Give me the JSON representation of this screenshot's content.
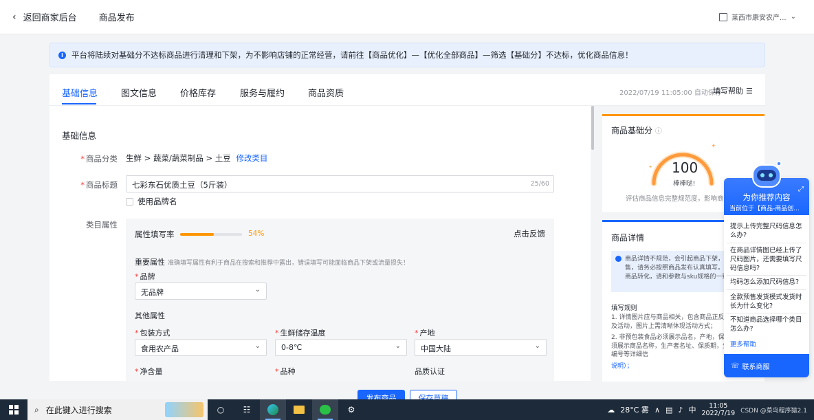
{
  "header": {
    "back_label": "返回商家后台",
    "page_title": "商品发布",
    "shop_name": "莱西市康安农产..."
  },
  "notice": {
    "text": "平台将陆续对基础分不达标商品进行清理和下架，为不影响店铺的正常经营，请前往【商品优化】—【优化全部商品】—筛选【基础分】不达标，优化商品信息！"
  },
  "tabs": {
    "items": [
      "基础信息",
      "图文信息",
      "价格库存",
      "服务与履约",
      "商品资质"
    ],
    "active": 0,
    "autosave": "2022/07/19 11:05:00 自动保存",
    "help": "填写帮助"
  },
  "form": {
    "section_title": "基础信息",
    "category_label": "商品分类",
    "category_value": "生鲜 > 蔬菜/蔬菜制品 > 土豆",
    "category_edit": "修改类目",
    "title_label": "商品标题",
    "title_value": "七彩东石优质土豆（5斤装）",
    "title_count": "25/60",
    "brand_checkbox": "使用品牌名",
    "attr_label": "类目属性",
    "attrs": {
      "fill_rate_label": "属性填写率",
      "fill_rate_pct": "54%",
      "fill_rate_value": 0.54,
      "feedback": "点击反馈",
      "important_title": "重要属性",
      "important_desc": "准确填写属性有利于商品在搜索和推荐中露出，错误填写可能面临商品下架或流量损失！",
      "brand_label": "品牌",
      "brand_value": "无品牌",
      "other_title": "其他属性",
      "packing_label": "包装方式",
      "packing_value": "食用农产品",
      "storage_label": "生鲜储存温度",
      "storage_value": "0-8℃",
      "origin_label": "产地",
      "origin_value": "中国大陆",
      "net_label": "净含量",
      "variety_label": "品种",
      "cert_label": "品质认证"
    }
  },
  "score": {
    "title": "商品基础分",
    "value": "100",
    "label": "棒棒哒!",
    "desc": "评估商品信息完整规范度，影响商品"
  },
  "detail": {
    "title": "商品详情",
    "warning": "商品详情不规范，会引起商品下架，的正常销售，请务必按照商品发布认真填写。为了提升商品转化，请和参数与sku规格的一致性。",
    "rules_title": "填写规则",
    "rules": [
      "1. 详情图片应与商品相关，包含商品正反面图，若涉及活动，图片上需清晰体现活动方式；",
      "2. 非预包装食品必须展示品名，产地，保包装食品必须展示商品名称，生产者名址、保质期，生产许可证编号等详细信",
      "说明）；"
    ]
  },
  "assistant": {
    "title": "为你推荐内容",
    "subtitle": "当前位于【商品-商品创...",
    "questions": [
      "提示上传完整尺码信息怎么办?",
      "在商品详情图已经上传了尺码图片，还需要填写尺码信息吗?",
      "均码怎么添加尺码信息?",
      "全款预售发货模式发货时长为什么变化?",
      "不知道商品选择哪个类目怎么办?"
    ],
    "more": "更多帮助",
    "contact": "联系商服"
  },
  "actions": {
    "publish": "发布商品",
    "draft": "保存草稿"
  },
  "taskbar": {
    "search_placeholder": "在此键入进行搜索",
    "weather": "28°C 雾",
    "time": "11:05",
    "date": "2022/7/19",
    "ime": "中",
    "watermark": "CSDN @菜鸟程序猿2.1"
  }
}
